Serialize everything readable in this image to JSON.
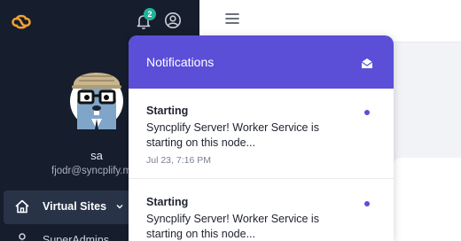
{
  "header": {
    "notification_count": "2"
  },
  "sidebar": {
    "user_name": "sa",
    "user_email": "fjodr@syncplify.me",
    "nav": [
      {
        "label": "Virtual Sites",
        "icon": "home-icon",
        "active": true
      },
      {
        "label": "SuperAdmins",
        "icon": "user-icon",
        "active": false
      }
    ]
  },
  "notifications": {
    "title": "Notifications",
    "items": [
      {
        "title": "Starting",
        "body": "Syncplify Server! Worker Service is starting on this node...",
        "time": "Jul 23, 7:16 PM",
        "unread": true
      },
      {
        "title": "Starting",
        "body": "Syncplify Server! Worker Service is starting on this node...",
        "unread": true
      }
    ]
  },
  "colors": {
    "sidebar_bg": "#161d2c",
    "accent": "#5b4fd8",
    "badge": "#23b39a",
    "logo": "#f0a030"
  }
}
